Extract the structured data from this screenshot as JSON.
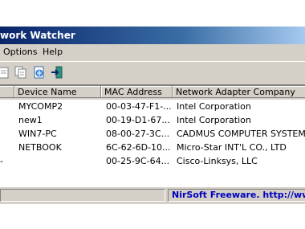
{
  "window": {
    "title": "work Watcher"
  },
  "menu": {
    "options": "Options",
    "help": "Help"
  },
  "toolbar": [
    {
      "icon": "properties-icon"
    },
    {
      "icon": "copy-icon"
    },
    {
      "icon": "html-report-icon"
    },
    {
      "icon": "exit-icon"
    }
  ],
  "list": {
    "columns": [
      "",
      "Device Name",
      "MAC Address",
      "Network Adapter Company"
    ],
    "rows": [
      {
        "ip": "",
        "device": "MYCOMP2",
        "mac": "00-03-47-F1-...",
        "company": "Intel Corporation"
      },
      {
        "ip": "",
        "device": "new1",
        "mac": "00-19-D1-67...",
        "company": "Intel Corporation"
      },
      {
        "ip": "",
        "device": "WIN7-PC",
        "mac": "08-00-27-3C...",
        "company": "CADMUS COMPUTER SYSTEMS"
      },
      {
        "ip": "",
        "device": "NETBOOK",
        "mac": "6C-62-6D-10...",
        "company": "Micro-Star INT'L CO., LTD"
      },
      {
        "ip": "-",
        "device": "",
        "mac": "00-25-9C-64...",
        "company": "Cisco-Linksys, LLC"
      }
    ]
  },
  "status": {
    "left": "",
    "right": "NirSoft Freeware.  http://www."
  },
  "colors": {
    "title_start": "#0a246a",
    "title_end": "#a6caf0",
    "status_link": "#0000c0"
  }
}
